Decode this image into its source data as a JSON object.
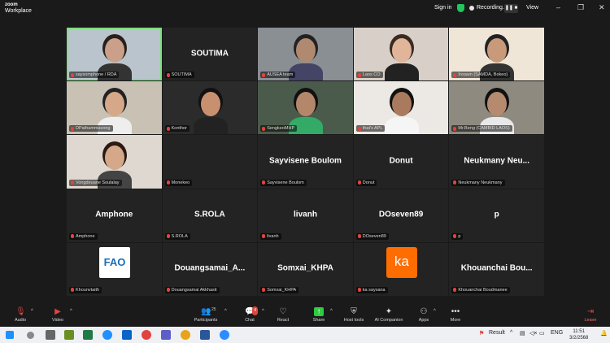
{
  "window": {
    "logo_line1": "zoom",
    "logo_line2": "Workplace",
    "sign_in": "Sign in",
    "recording": "Recording...",
    "view": "View"
  },
  "participants_tiles": [
    {
      "label": "saysomphone / RDA",
      "bigname": "",
      "video": true,
      "active": true
    },
    {
      "label": "SOUTIMA",
      "bigname": "SOUTIMA",
      "video": false
    },
    {
      "label": "AUSEA team",
      "bigname": "",
      "video": true
    },
    {
      "label": "Laos CO",
      "bigname": "",
      "video": true
    },
    {
      "label": "Inxawn (SAMDA, Bokeo)",
      "bigname": "",
      "video": true
    },
    {
      "label": "DPathammavong",
      "bigname": "",
      "video": true
    },
    {
      "label": "Konthor",
      "bigname": "",
      "video": true
    },
    {
      "label": "SengkeoMHP",
      "bigname": "",
      "video": true
    },
    {
      "label": "that's APL",
      "bigname": "",
      "video": true
    },
    {
      "label": "Mr.Beng (CAMBID LAOS)",
      "bigname": "",
      "video": true
    },
    {
      "label": "Vongdeuane Soulalay",
      "bigname": "",
      "video": true
    },
    {
      "label": "Monekeo",
      "bigname": "",
      "video": false
    },
    {
      "label": "Sayvisene Boulom",
      "bigname": "Sayvisene Boulom",
      "video": false
    },
    {
      "label": "Donut",
      "bigname": "Donut",
      "video": false
    },
    {
      "label": "Neukmany Neukmany",
      "bigname": "Neukmany  Neu...",
      "video": false
    },
    {
      "label": "Amphone",
      "bigname": "Amphone",
      "video": false
    },
    {
      "label": "S.ROLA",
      "bigname": "S.ROLA",
      "video": false
    },
    {
      "label": "livanh",
      "bigname": "livanh",
      "video": false
    },
    {
      "label": "DOseven89",
      "bigname": "DOseven89",
      "video": false
    },
    {
      "label": "p",
      "bigname": "p",
      "video": false
    },
    {
      "label": "Khounvtaith",
      "bigname": "",
      "video": false,
      "logo": "FAO"
    },
    {
      "label": "Douangsamai Akkhasit",
      "bigname": "Douangsamai_A...",
      "video": false
    },
    {
      "label": "Somxai_KHPA",
      "bigname": "Somxai_KHPA",
      "video": false
    },
    {
      "label": "ka saysana",
      "bigname": "",
      "video": false,
      "logo": "ka"
    },
    {
      "label": "Khouanchai Boudmanee",
      "bigname": "Khouanchai  Bou...",
      "video": false
    }
  ],
  "toolbar": {
    "audio": "Audio",
    "video": "Video",
    "participants": "Participants",
    "participants_count": "25",
    "chat": "Chat",
    "chat_badge": "4",
    "react": "React",
    "share": "Share",
    "host_tools": "Host tools",
    "ai_companion": "AI Companion",
    "apps": "Apps",
    "more": "More",
    "leave": "Leave"
  },
  "taskbar": {
    "result": "Result",
    "lang": "ENG",
    "time": "11:51",
    "date": "3/2/2568"
  }
}
